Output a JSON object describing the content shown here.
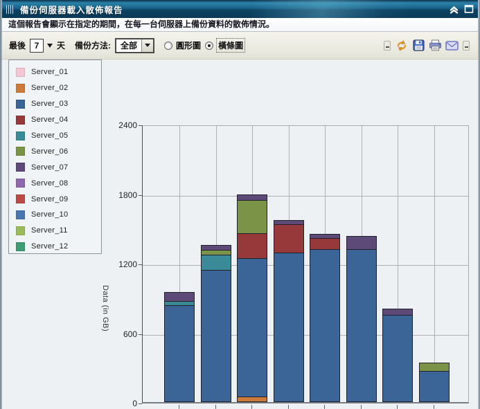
{
  "window": {
    "title": "備份伺服器載入散佈報告",
    "description": "這個報告會顯示在指定的期間，在每一台伺服器上備份資料的散佈情況。"
  },
  "toolbar": {
    "last_label": "最後",
    "days_value": "7",
    "days_unit": "天",
    "method_label": "備份方法:",
    "method_value": "全部",
    "radio_pie_label": "圓形圖",
    "radio_bar_label": "橫條圖",
    "radio_selected": "橫條圖",
    "icons": [
      "refresh-icon",
      "save-icon",
      "print-icon",
      "email-icon"
    ]
  },
  "titlebar_icons": [
    "grip-icon",
    "collapse-icon",
    "maximize-icon"
  ],
  "legend": {
    "items": [
      {
        "label": "Server_01",
        "color": "#F5C7D3"
      },
      {
        "label": "Server_02",
        "color": "#CE7B3A"
      },
      {
        "label": "Server_03",
        "color": "#3B6596"
      },
      {
        "label": "Server_04",
        "color": "#97393A"
      },
      {
        "label": "Server_05",
        "color": "#3A8A97"
      },
      {
        "label": "Server_06",
        "color": "#7B9346"
      },
      {
        "label": "Server_07",
        "color": "#5D4A79"
      },
      {
        "label": "Server_08",
        "color": "#8E68AE"
      },
      {
        "label": "Server_09",
        "color": "#BE4A45"
      },
      {
        "label": "Server_10",
        "color": "#4A77B0"
      },
      {
        "label": "Server_11",
        "color": "#9ABB59"
      },
      {
        "label": "Server_12",
        "color": "#3F9D73"
      }
    ]
  },
  "chart_data": {
    "type": "bar",
    "stacked": true,
    "title": "",
    "xlabel": "",
    "ylabel": "Data (in GB)",
    "ylim": [
      0,
      2400
    ],
    "yticks": [
      0,
      600,
      1200,
      1800,
      2400
    ],
    "grid": true,
    "legend_position": "left",
    "x_axis_labels_visible": false,
    "bars": [
      {
        "total": 960,
        "segments": [
          {
            "server": "Server_03",
            "value": 835
          },
          {
            "server": "Server_05",
            "value": 40
          },
          {
            "server": "Server_07",
            "value": 85
          }
        ]
      },
      {
        "total": 1375,
        "segments": [
          {
            "server": "Server_03",
            "value": 1140
          },
          {
            "server": "Server_05",
            "value": 135
          },
          {
            "server": "Server_06",
            "value": 50
          },
          {
            "server": "Server_07",
            "value": 50
          }
        ]
      },
      {
        "total": 1815,
        "segments": [
          {
            "server": "Server_02",
            "value": 45
          },
          {
            "server": "Server_03",
            "value": 1205
          },
          {
            "server": "Server_04",
            "value": 220
          },
          {
            "server": "Server_06",
            "value": 290
          },
          {
            "server": "Server_07",
            "value": 55
          }
        ]
      },
      {
        "total": 1585,
        "segments": [
          {
            "server": "Server_03",
            "value": 1290
          },
          {
            "server": "Server_04",
            "value": 250
          },
          {
            "server": "Server_07",
            "value": 45
          }
        ]
      },
      {
        "total": 1460,
        "segments": [
          {
            "server": "Server_03",
            "value": 1320
          },
          {
            "server": "Server_04",
            "value": 100
          },
          {
            "server": "Server_07",
            "value": 40
          }
        ]
      },
      {
        "total": 1440,
        "segments": [
          {
            "server": "Server_03",
            "value": 1320
          },
          {
            "server": "Server_07",
            "value": 120
          }
        ]
      },
      {
        "total": 810,
        "segments": [
          {
            "server": "Server_03",
            "value": 755
          },
          {
            "server": "Server_07",
            "value": 55
          }
        ]
      },
      {
        "total": 345,
        "segments": [
          {
            "server": "Server_03",
            "value": 270
          },
          {
            "server": "Server_06",
            "value": 75
          }
        ]
      }
    ]
  }
}
